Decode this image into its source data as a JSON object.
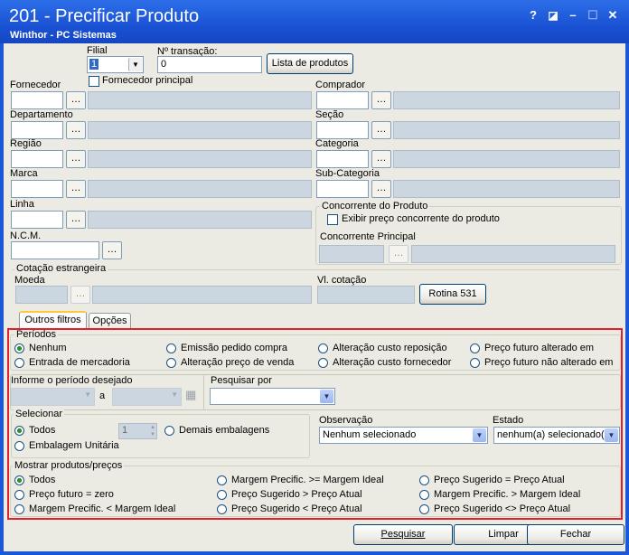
{
  "window": {
    "title": "201 - Precificar Produto",
    "subtitle": "Winthor - PC Sistemas",
    "help": "?",
    "min": "–",
    "max": "☐",
    "close": "✕"
  },
  "top": {
    "filial_label": "Filial",
    "filial_value": "1",
    "transacao_label": "Nº transação:",
    "transacao_value": "0",
    "lista_btn": "Lista de produtos",
    "fornecedor_principal": "Fornecedor principal"
  },
  "left_fields": [
    "Fornecedor",
    "Departamento",
    "Região",
    "Marca",
    "Linha",
    "N.C.M."
  ],
  "right_fields": [
    "Comprador",
    "Seção",
    "Categoria",
    "Sub-Categoria"
  ],
  "concorrente": {
    "group": "Concorrente do Produto",
    "check": "Exibir preço concorrente do produto",
    "principal": "Concorrente Principal"
  },
  "cotacao": {
    "group": "Cotação estrangeira",
    "moeda": "Moeda",
    "vl": "Vl. cotação",
    "rotina": "Rotina 531"
  },
  "tabs": {
    "outros": "Outros filtros",
    "opcoes": "Opções"
  },
  "periodos": {
    "title": "Períodos",
    "items": [
      "Nenhum",
      "Emissão pedido compra",
      "Alteração custo reposição",
      "Preço futuro alterado em",
      "Entrada de mercadoria",
      "Alteração preço de venda",
      "Alteração custo fornecedor",
      "Preço futuro não alterado em"
    ]
  },
  "periodo": {
    "label": "Informe o período desejado",
    "a": "a",
    "pesquisar_por": "Pesquisar por"
  },
  "selecionar": {
    "title": "Selecionar",
    "todos": "Todos",
    "qty": "1",
    "demais": "Demais embalagens",
    "unitaria": "Embalagem Unitária"
  },
  "observacao": {
    "label": "Observação",
    "value": "Nenhum selecionado"
  },
  "estado": {
    "label": "Estado",
    "value": "nenhum(a) selecionado(a)"
  },
  "mostrar": {
    "title": "Mostrar produtos/preços",
    "items": [
      "Todos",
      "Margem Precific. >= Margem Ideal",
      "Preço Sugerido = Preço Atual",
      "Preço futuro = zero",
      "Preço Sugerido > Preço Atual",
      "Margem Precific. > Margem Ideal",
      "Margem Precific. < Margem Ideal",
      "Preço Sugerido < Preço Atual",
      "Preço Sugerido <> Preço Atual"
    ]
  },
  "buttons": {
    "pesquisar": "Pesquisar",
    "limpar": "Limpar",
    "fechar": "Fechar"
  }
}
